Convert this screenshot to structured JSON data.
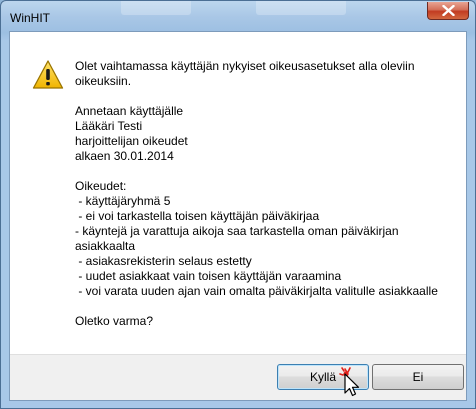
{
  "window": {
    "title": "WinHIT",
    "close_label": "Close"
  },
  "dialog": {
    "intro": "Olet vaihtamassa käyttäjän nykyiset oikeusasetukset alla oleviin oikeuksiin.",
    "grant": {
      "line1": "Annetaan käyttäjälle",
      "user": "Lääkäri Testi",
      "role": "harjoittelijan oikeudet",
      "from": "alkaen 30.01.2014"
    },
    "rights_header": "Oikeudet:",
    "rights": [
      " - käyttäjäryhmä 5",
      " - ei voi tarkastella toisen käyttäjän päiväkirjaa",
      " - käyntejä ja varattuja aikoja saa tarkastella oman päiväkirjan asiakkaalta",
      " - asiakasrekisterin selaus estetty",
      " - uudet asiakkaat vain toisen käyttäjän varaamina",
      " - voi varata uuden ajan vain omalta päiväkirjalta valitulle asiakkaalle"
    ],
    "question": "Oletko varma?"
  },
  "buttons": {
    "yes": "Kyllä",
    "no": "Ei"
  },
  "icons": {
    "warning": "warning-icon",
    "close": "close-icon",
    "cursor": "mouse-cursor-icon"
  },
  "colors": {
    "titlebar": "#a9c7e6",
    "close_button": "#c23b21",
    "warning_fill": "#f5c400",
    "default_button_border": "#3c7fb1"
  }
}
